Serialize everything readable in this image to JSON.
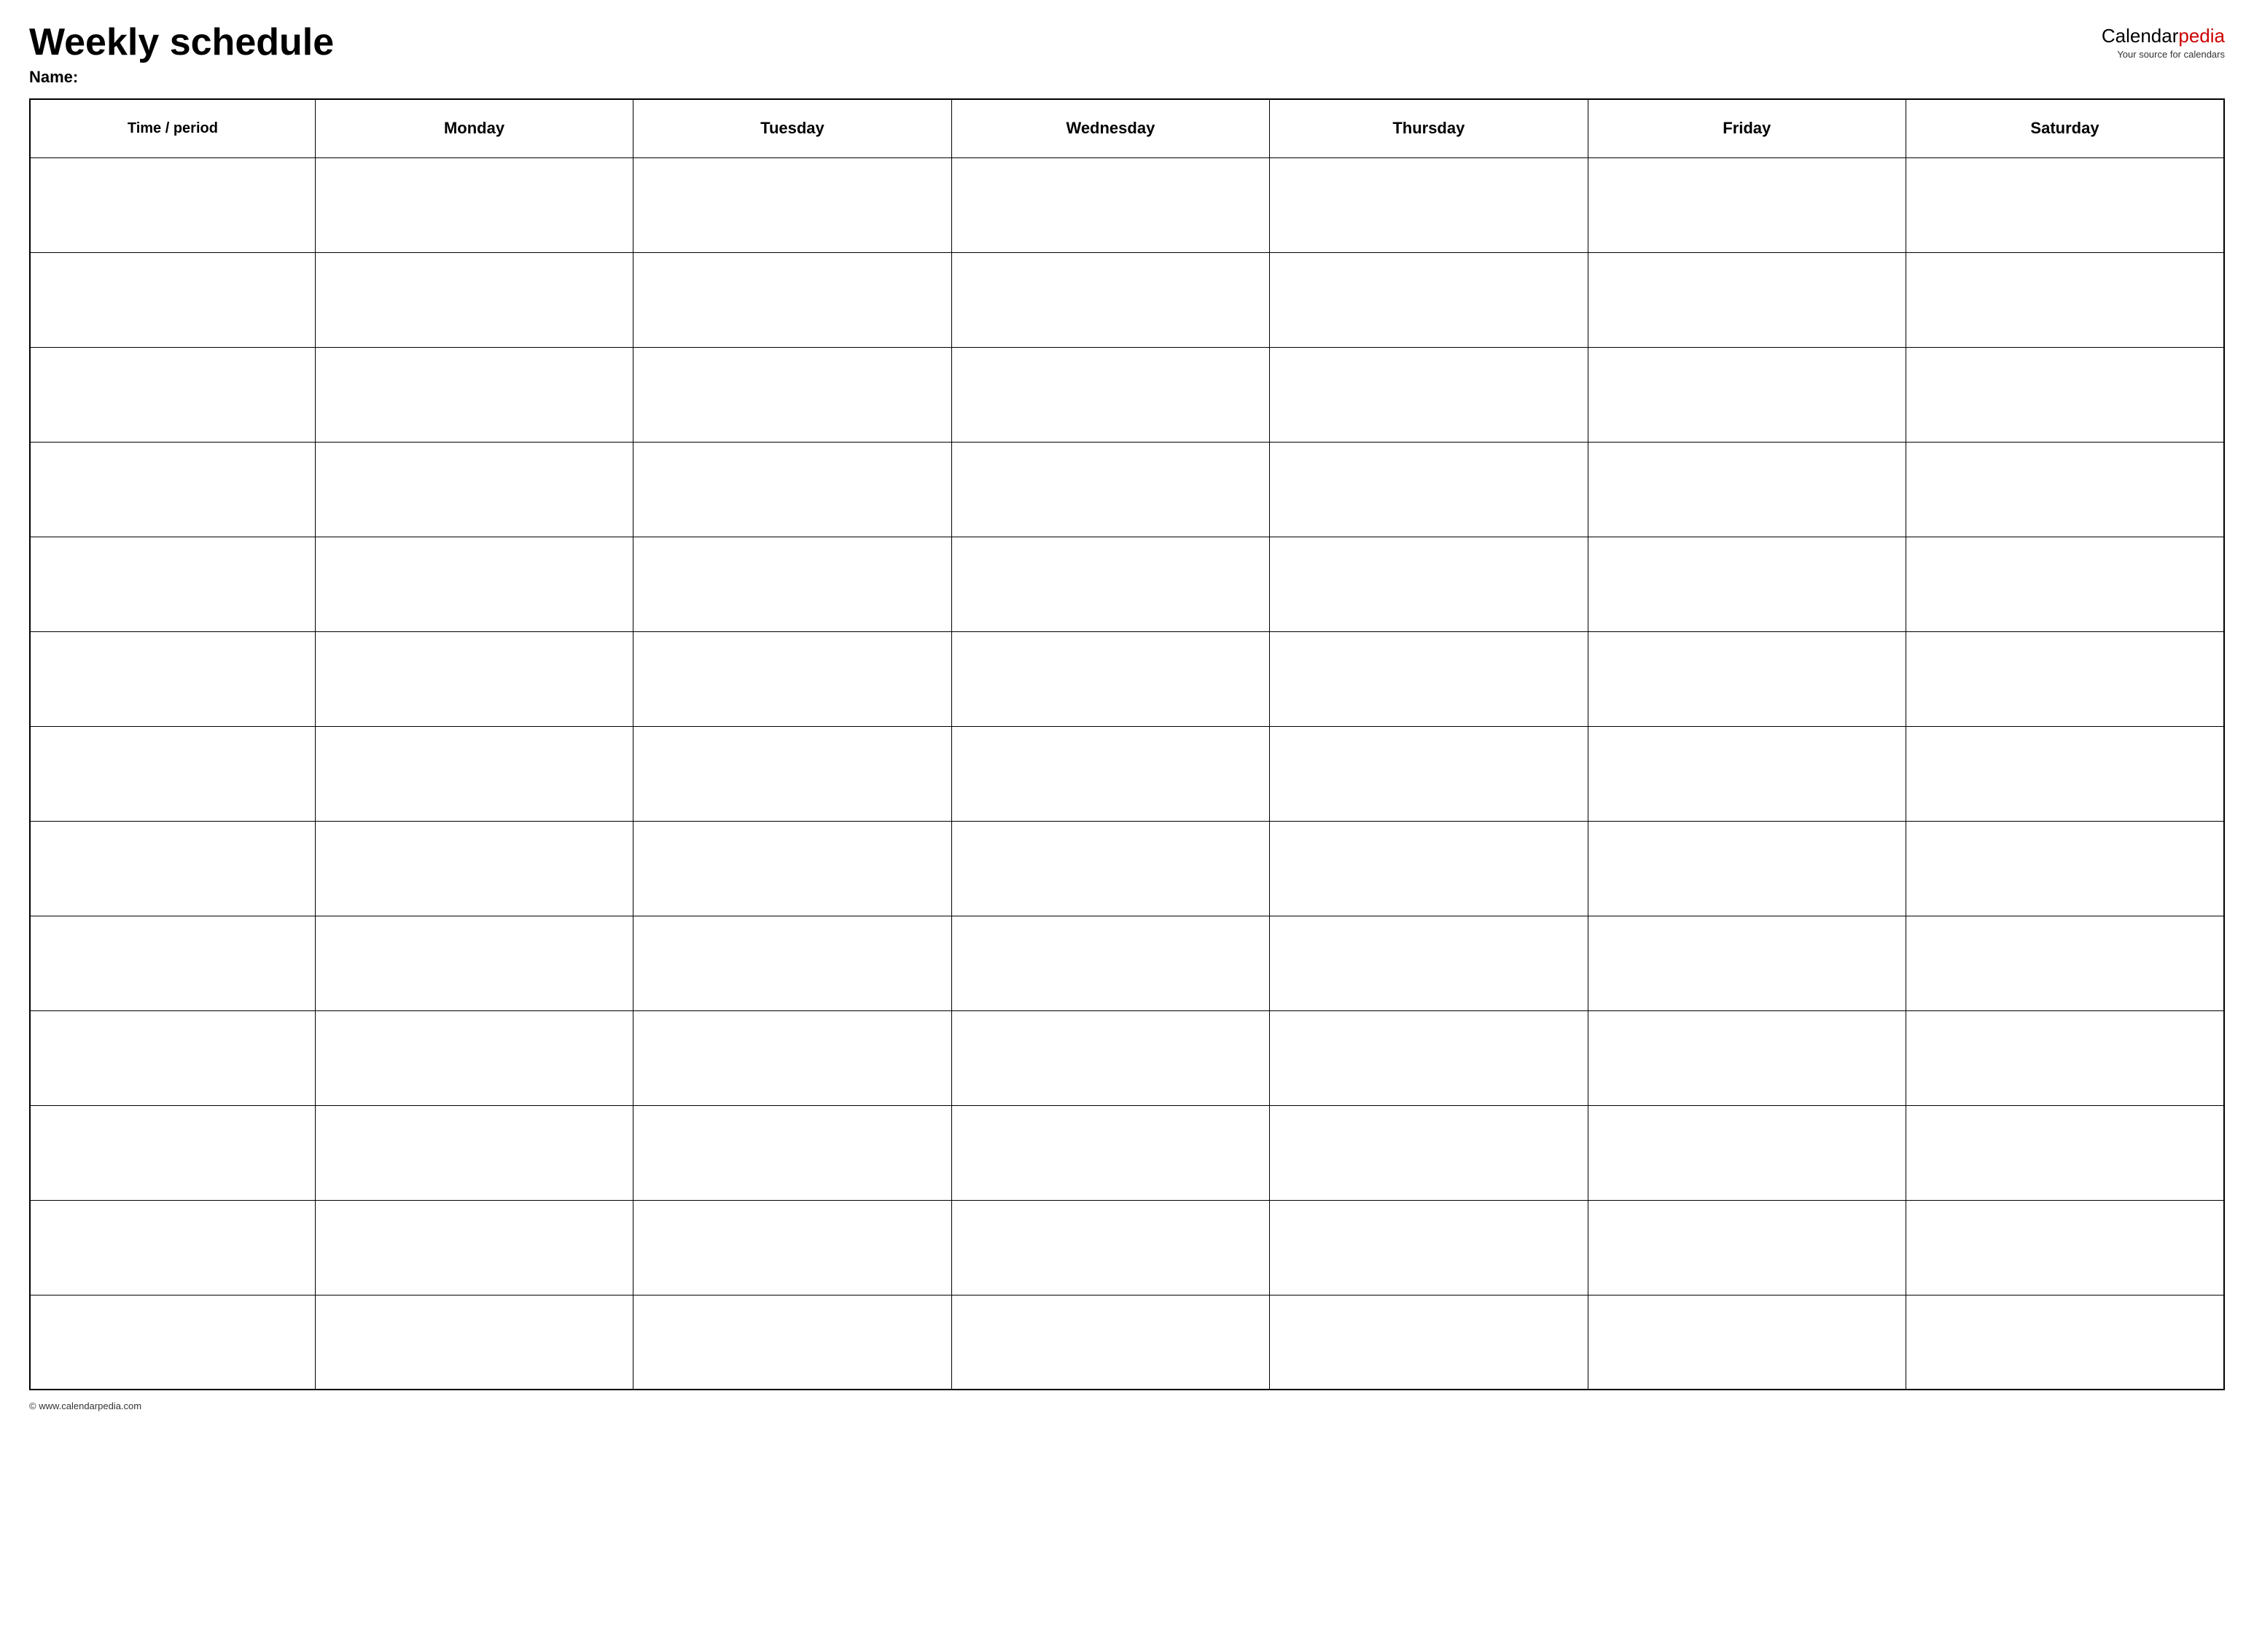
{
  "header": {
    "title": "Weekly schedule",
    "name_label": "Name:",
    "logo_main": "Calendar",
    "logo_accent": "pedia",
    "logo_sub": "Your source for calendars"
  },
  "table": {
    "columns": [
      "Time / period",
      "Monday",
      "Tuesday",
      "Wednesday",
      "Thursday",
      "Friday",
      "Saturday"
    ],
    "row_count": 13
  },
  "footer": {
    "text": "© www.calendarpedia.com"
  }
}
